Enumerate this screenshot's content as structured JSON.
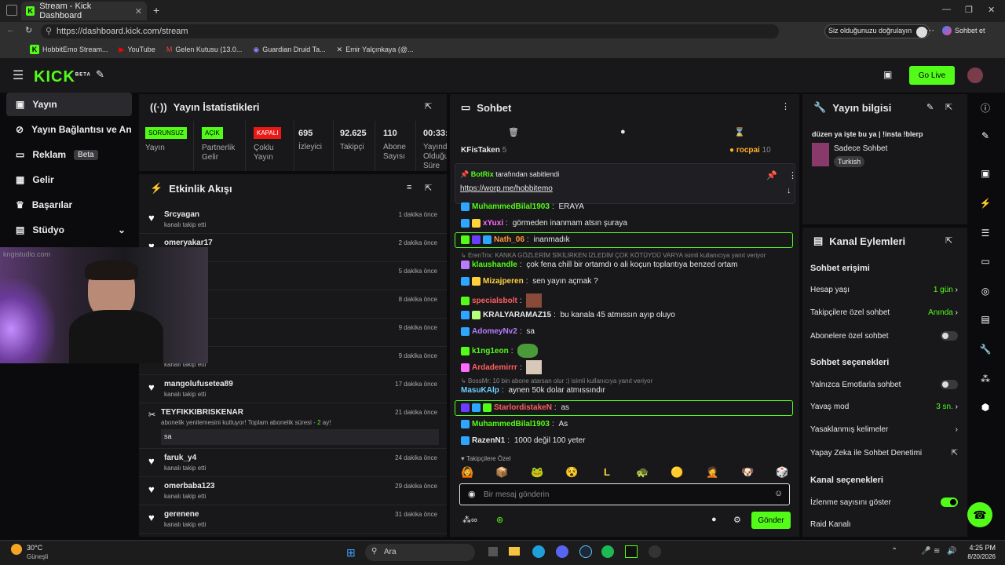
{
  "browser": {
    "tab_title": "Stream - Kick Dashboard",
    "url": "https://dashboard.kick.com/stream",
    "profile_status": "Siz olduğunuzu doğrulayın",
    "chat_button": "Sohbet et",
    "bookmarks": [
      "HobbitEmo Stream...",
      "YouTube",
      "Gelen Kutusu (13.0...",
      "Guardian Druid Ta...",
      "Emir Yalçınkaya (@..."
    ]
  },
  "header": {
    "logo": "KICK",
    "logo_badge": "BETA",
    "go_live": "Go Live"
  },
  "sidebar": {
    "items": [
      {
        "label": "Yayın"
      },
      {
        "label": "Yayın Bağlantısı ve Anahtar"
      },
      {
        "label": "Reklam",
        "badge": "Beta"
      },
      {
        "label": "Gelir"
      },
      {
        "label": "Başarılar"
      },
      {
        "label": "Stüdyo"
      }
    ]
  },
  "webcam_watermark": "kngistudio.com",
  "stats": {
    "title": "Yayın İstatistikleri",
    "cells": [
      {
        "tag": "SORUNSUZ",
        "label": "Yayın"
      },
      {
        "tag": "AÇIK",
        "label": "Partnerlik Gelir"
      },
      {
        "tag": "KAPALI",
        "label": "Çoklu Yayın"
      },
      {
        "value": "695",
        "label": "İzleyici"
      },
      {
        "value": "92.625",
        "label": "Takipçi"
      },
      {
        "value": "110",
        "label": "Abone Sayısı"
      },
      {
        "value": "00:33:",
        "label": "Yayında Olduğu Süre"
      }
    ]
  },
  "activity": {
    "title": "Etkinlik Akışı",
    "events": [
      {
        "name": "Srcyagan",
        "sub": "kanalı takip etti",
        "time": "1 dakika önce"
      },
      {
        "name": "omeryakar17",
        "sub": "",
        "time": "2 dakika önce"
      },
      {
        "name": "",
        "sub": "",
        "time": "5 dakika önce"
      },
      {
        "name": "",
        "sub": "",
        "time": "8 dakika önce"
      },
      {
        "name": "",
        "sub": "",
        "time": "9 dakika önce"
      },
      {
        "name": "",
        "sub": "kanalı takip etti",
        "time": "9 dakika önce"
      },
      {
        "name": "mangolufusetea89",
        "sub": "kanalı takip etti",
        "time": "17 dakika önce"
      }
    ],
    "resub": {
      "name": "TEYFIKKIBRISKENAR",
      "text": "abonelik yenilemesini kutluyor! Toplam abonelik süresi - ",
      "months": "2",
      "suffix": "ay!",
      "message": "sa",
      "time": "21 dakika önce"
    },
    "events2": [
      {
        "name": "faruk_y4",
        "sub": "kanalı takip etti",
        "time": "24 dakika önce"
      },
      {
        "name": "omerbaba123",
        "sub": "kanalı takip etti",
        "time": "29 dakika önce"
      },
      {
        "name": "gerenene",
        "sub": "kanalı takip etti",
        "time": "31 dakika önce"
      }
    ]
  },
  "chat": {
    "title": "Sohbet",
    "leaders": {
      "left_name": "KFisTaken",
      "left_count": "5",
      "right_name": "rocpai",
      "right_count": "10"
    },
    "pinned": {
      "by": "BotRix",
      "by_suffix": "tarafından sabitlendi",
      "link": "https://worp.me/hobbitemo"
    },
    "messages": [
      {
        "user": "MuhammedBilal1903",
        "text": "ERAYA",
        "color": "#53fc18"
      },
      {
        "user": "xYuxi",
        "text": "görmeden inanmam atsın şuraya",
        "color": "#ff6bff"
      },
      {
        "user": "Nath_06",
        "text": "inanmadık",
        "color": "#ff9a3c",
        "highlight": true
      },
      {
        "reply": "ErenTrix: KANKA GÖZLERİM SİKİLİRKEN İZLEDİM ÇOK KÖTÜYDÜ VARYA isimli kullanıcıya yanıt veriyor"
      },
      {
        "user": "klaushandle",
        "text": "çok fena chill bir ortamdı o ali koçun toplantıya benzed ortam",
        "color": "#53fc18"
      },
      {
        "user": "Mizajperen",
        "text": "sen yayın açmak ?",
        "color": "#ffd23c"
      },
      {
        "user": "specialsbolt",
        "text": "",
        "color": "#ff5f5f"
      },
      {
        "user": "KRALYARAMAZ15",
        "text": "bu kanala 45 atmıssın ayıp oluyo",
        "color": "#e8e8e8"
      },
      {
        "user": "AdomeyNv2",
        "text": "sa",
        "color": "#b77bff"
      },
      {
        "user": "k1ng1eon",
        "text": "",
        "color": "#53fc18"
      },
      {
        "user": "Ardademirrr",
        "text": "",
        "color": "#ff5f5f"
      },
      {
        "reply": "BossMr: 10 bin abone atarsan olur :) isimli kullanıcıya yanıt veriyor"
      },
      {
        "user": "MasuKAlp",
        "text": "aynen 50k dolar atmıssındır",
        "color": "#6fd0ff"
      },
      {
        "user": "StarlordistakeN",
        "text": "as",
        "color": "#ff5f5f",
        "highlight": true
      },
      {
        "user": "MuhammedBilal1903",
        "text": "As",
        "color": "#53fc18"
      },
      {
        "user": "RazenN1",
        "text": "1000 değil 100 yeter",
        "color": "#e8e8e8"
      }
    ],
    "followers_only": "Takipçilere Özel",
    "input_placeholder": "Bir mesaj gönderin",
    "send": "Gönder"
  },
  "stream_info": {
    "title": "Yayın bilgisi",
    "stream_title": "düzen ya işte bu ya | !insta !blerp",
    "category": "Sadece Sohbet",
    "tag": "Turkish"
  },
  "channel_actions": {
    "title": "Kanal Eylemleri",
    "chat_access": "Sohbet erişimi",
    "account_age": {
      "label": "Hesap yaşı",
      "value": "1 gün"
    },
    "followers_chat": {
      "label": "Takipçilere özel sohbet",
      "value": "Anında"
    },
    "subs_chat": {
      "label": "Abonelere özel sohbet"
    },
    "chat_options": "Sohbet seçenekleri",
    "emote_only": {
      "label": "Yalnızca Emotlarla sohbet"
    },
    "slow_mode": {
      "label": "Yavaş mod",
      "value": "3 sn."
    },
    "banned_words": {
      "label": "Yasaklanmış kelimeler"
    },
    "ai_moderation": {
      "label": "Yapay Zeka ile Sohbet Denetimi"
    },
    "channel_options": "Kanal seçenekleri",
    "show_viewers": {
      "label": "İzlenme sayısını göster"
    },
    "raid": {
      "label": "Raid Kanalı"
    }
  },
  "taskbar": {
    "temp": "30°C",
    "weather": "Güneşli",
    "search": "Ara",
    "time": "4:25 PM",
    "date": "8/20/2026"
  },
  "colors": {
    "accent": "#53fc18",
    "panel": "#18181b",
    "bg": "#0b0b0d"
  }
}
